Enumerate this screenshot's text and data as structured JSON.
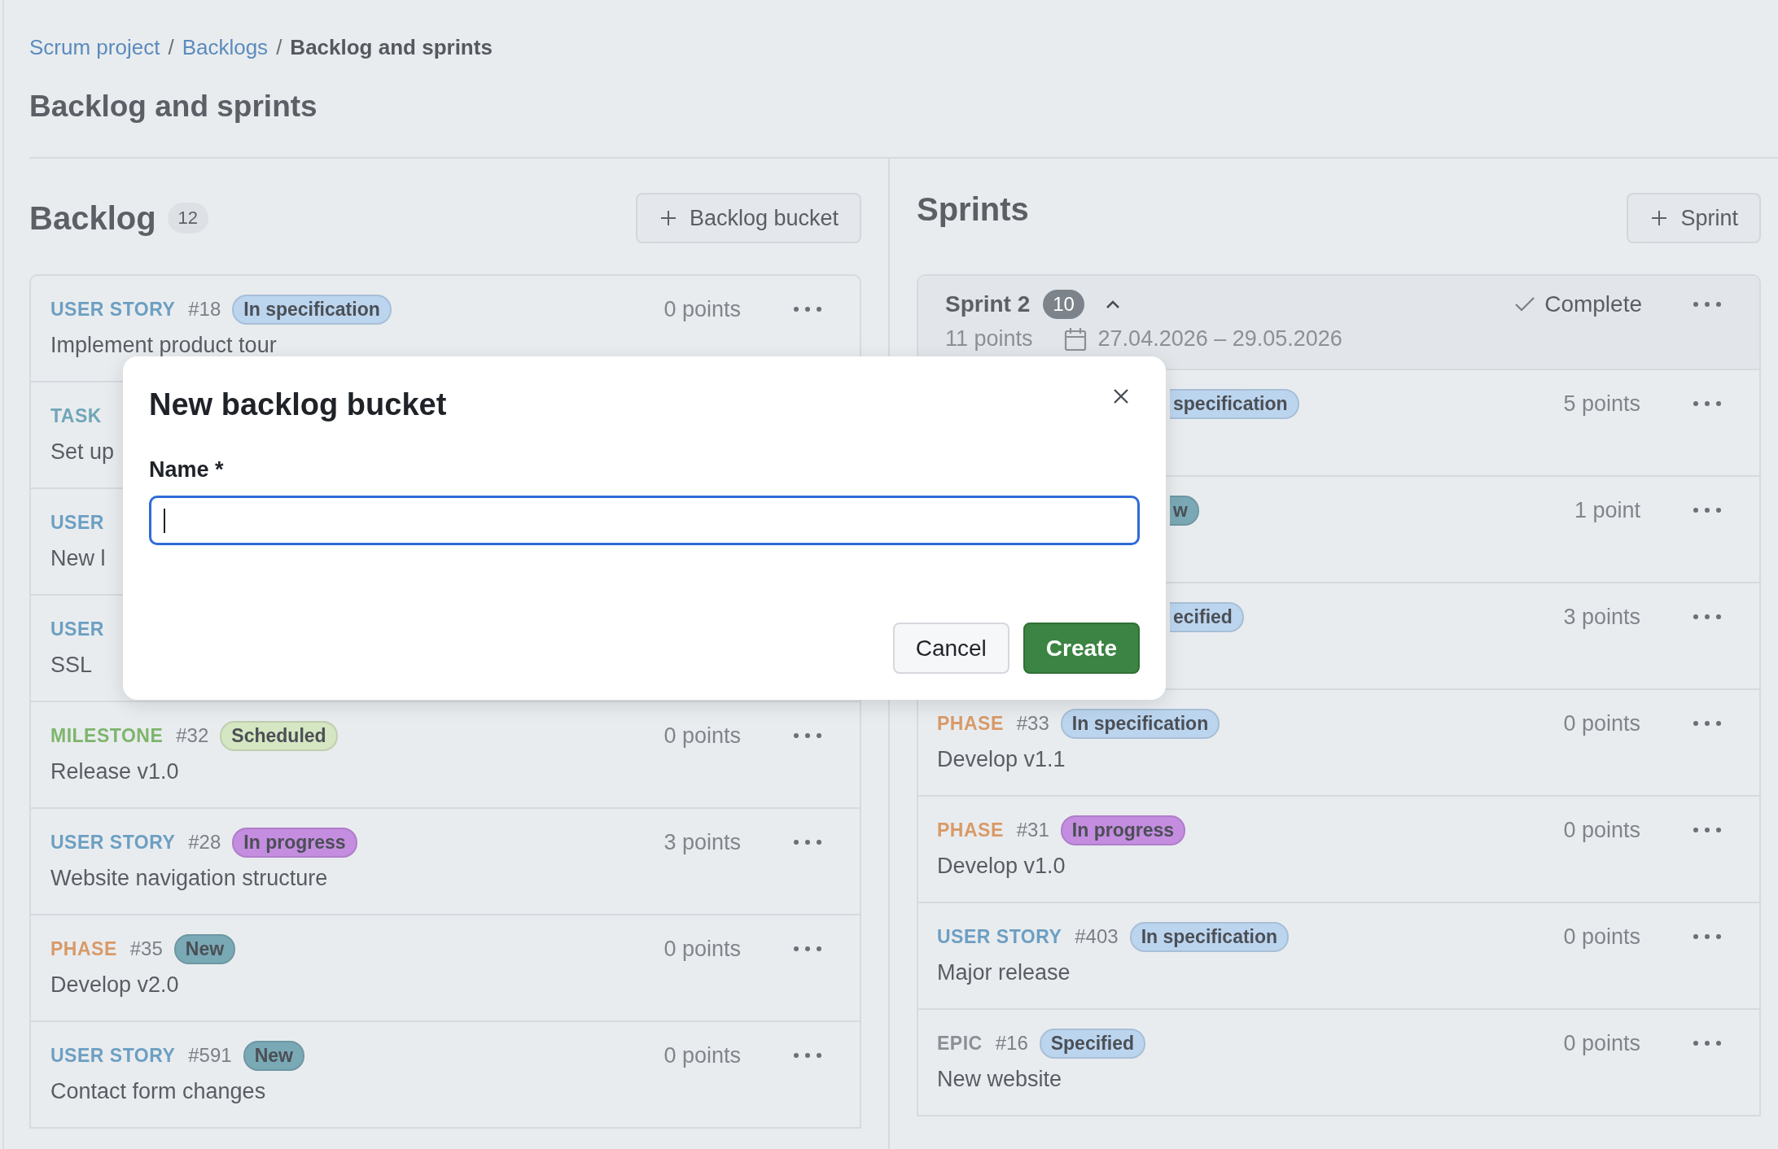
{
  "breadcrumb": [
    {
      "label": "Scrum project",
      "kind": "link"
    },
    {
      "label": "/",
      "kind": "separator"
    },
    {
      "label": "Backlogs",
      "kind": "link"
    },
    {
      "label": "/",
      "kind": "separator"
    },
    {
      "label": "Backlog and sprints",
      "kind": "current"
    }
  ],
  "title": "Backlog and sprints",
  "backlog": {
    "heading": "Backlog",
    "count": "12",
    "add_button": "Backlog bucket",
    "items": [
      {
        "kind": "user_story",
        "type": "USER STORY",
        "number": "#18",
        "status": {
          "label": "In specification",
          "color": "#bcd5ef"
        },
        "points": "0 points",
        "title": "Implement product tour"
      },
      {
        "kind": "task",
        "type": "TASK",
        "title": "Set up"
      },
      {
        "kind": "user_story",
        "type": "USER",
        "title": "New l"
      },
      {
        "kind": "user_story",
        "type": "USER",
        "title": "SSL"
      },
      {
        "kind": "milestone",
        "type": "MILESTONE",
        "number": "#32",
        "status": {
          "label": "Scheduled",
          "color": "#d5e6c2"
        },
        "points": "0 points",
        "title": "Release v1.0"
      },
      {
        "kind": "user_story",
        "type": "USER STORY",
        "number": "#28",
        "status": {
          "label": "In progress",
          "color": "#c48de0"
        },
        "points": "3 points",
        "title": "Website navigation structure"
      },
      {
        "kind": "phase",
        "type": "PHASE",
        "number": "#35",
        "status": {
          "label": "New",
          "color": "#7aa9b6"
        },
        "points": "0 points",
        "title": "Develop v2.0"
      },
      {
        "kind": "user_story",
        "type": "USER STORY",
        "number": "#591",
        "status": {
          "label": "New",
          "color": "#7aa9b6"
        },
        "points": "0 points",
        "title": "Contact form changes"
      }
    ]
  },
  "sprints": {
    "heading": "Sprints",
    "add_button": "Sprint",
    "sprint": {
      "name": "Sprint 2",
      "count": "10",
      "expanded": true,
      "complete_button": "Complete",
      "points": "11 points",
      "dates": "27.04.2026 – 29.05.2026",
      "items": [
        {
          "kind": "cut",
          "status": {
            "label": "specification",
            "color": "#bcd5ef"
          },
          "points": "5 points"
        },
        {
          "kind": "cut",
          "status": {
            "label": "w",
            "color": "#7aa9b6"
          },
          "points": "1 point"
        },
        {
          "kind": "cut",
          "status": {
            "label": "ecified",
            "color": "#bcd5ef"
          },
          "points": "3 points"
        },
        {
          "kind": "phase",
          "type": "PHASE",
          "number": "#33",
          "status": {
            "label": "In specification",
            "color": "#bcd5ef"
          },
          "points": "0 points",
          "title": "Develop v1.1"
        },
        {
          "kind": "phase",
          "type": "PHASE",
          "number": "#31",
          "status": {
            "label": "In progress",
            "color": "#c48de0"
          },
          "points": "0 points",
          "title": "Develop v1.0"
        },
        {
          "kind": "user_story",
          "type": "USER STORY",
          "number": "#403",
          "status": {
            "label": "In specification",
            "color": "#bcd5ef"
          },
          "points": "0 points",
          "title": "Major release"
        },
        {
          "kind": "epic",
          "type": "EPIC",
          "number": "#16",
          "status": {
            "label": "Specified",
            "color": "#bcd5ef"
          },
          "points": "0 points",
          "title": "New website"
        }
      ]
    }
  },
  "dialog": {
    "title": "New backlog bucket",
    "field_label": "Name *",
    "buttons": [
      {
        "label": "Cancel",
        "kind": "secondary"
      },
      {
        "label": "Create",
        "kind": "primary"
      }
    ]
  }
}
